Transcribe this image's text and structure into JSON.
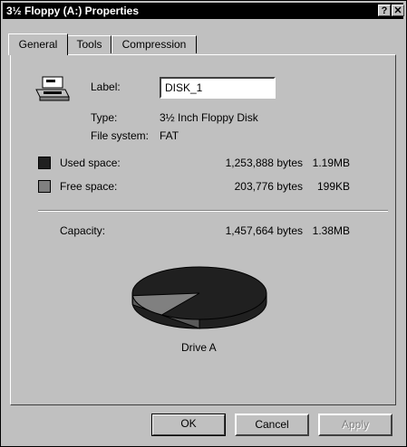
{
  "window": {
    "title": "3½ Floppy (A:) Properties",
    "help_glyph": "?",
    "close_glyph": "✕"
  },
  "tabs": [
    {
      "label": "General",
      "active": true
    },
    {
      "label": "Tools",
      "active": false
    },
    {
      "label": "Compression",
      "active": false
    }
  ],
  "general": {
    "label_text": "Label:",
    "label_value": "DISK_1",
    "type_label": "Type:",
    "type_value": "3½ Inch Floppy Disk",
    "fs_label": "File system:",
    "fs_value": "FAT",
    "used_label": "Used space:",
    "used_bytes": "1,253,888 bytes",
    "used_short": "1.19MB",
    "free_label": "Free space:",
    "free_bytes": "203,776 bytes",
    "free_short": "199KB",
    "capacity_label": "Capacity:",
    "capacity_bytes": "1,457,664 bytes",
    "capacity_short": "1.38MB",
    "drive_caption": "Drive A"
  },
  "pie": {
    "used_fraction": 0.86,
    "used_color": "#202020",
    "free_color": "#808080"
  },
  "buttons": {
    "ok": "OK",
    "cancel": "Cancel",
    "apply": "Apply"
  },
  "colors": {
    "used_swatch": "#202020",
    "free_swatch": "#808080",
    "titlebar": "#000000",
    "face": "#c0c0c0"
  }
}
